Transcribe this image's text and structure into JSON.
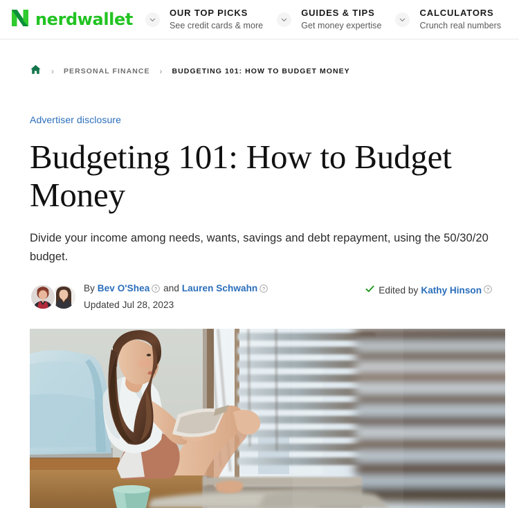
{
  "header": {
    "brand": {
      "wordmark": "nerdwallet",
      "logo_icon": "nerdwallet-n-logo",
      "color": "#22c322"
    },
    "nav": [
      {
        "title": "OUR TOP PICKS",
        "subtitle": "See credit cards & more",
        "caret_icon": "chevron-down-icon"
      },
      {
        "title": "GUIDES & TIPS",
        "subtitle": "Get money expertise",
        "caret_icon": "chevron-down-icon"
      },
      {
        "title": "CALCULATORS",
        "subtitle": "Crunch real numbers",
        "caret_icon": "chevron-down-icon"
      }
    ]
  },
  "breadcrumb": {
    "home_icon": "home-icon",
    "separator": "›",
    "items": [
      {
        "label": "PERSONAL FINANCE",
        "current": false
      },
      {
        "label": "BUDGETING 101: HOW TO BUDGET MONEY",
        "current": true
      }
    ]
  },
  "article": {
    "disclosure": "Advertiser disclosure",
    "title": "Budgeting 101: How to Budget Money",
    "deck": "Divide your income among needs, wants, savings and debt repayment, using the 50/30/20 budget.",
    "byline": {
      "by_label": "By",
      "authors": [
        {
          "name": "Bev O'Shea",
          "info_icon": "question-mark-info-icon"
        },
        {
          "name": "Lauren Schwahn",
          "info_icon": "question-mark-info-icon"
        }
      ],
      "conjunction": "and",
      "updated": "Updated Jul 28, 2023",
      "avatar_alt_1": "author-avatar-bev-oshea",
      "avatar_alt_2": "author-avatar-lauren-schwahn"
    },
    "editor": {
      "check_icon": "green-check-icon",
      "label": "Edited by",
      "name": "Kathy Hinson",
      "info_icon": "question-mark-info-icon"
    },
    "hero_image_alt": "Woman sitting on floor against bed writing in notebook by a window with blinds"
  },
  "colors": {
    "brand_green": "#22c322",
    "home_green": "#13754b",
    "link_blue": "#2a6ebb",
    "check_green": "#149414",
    "text_dark": "#1a1a1a",
    "text_muted": "#6e6e6e"
  }
}
